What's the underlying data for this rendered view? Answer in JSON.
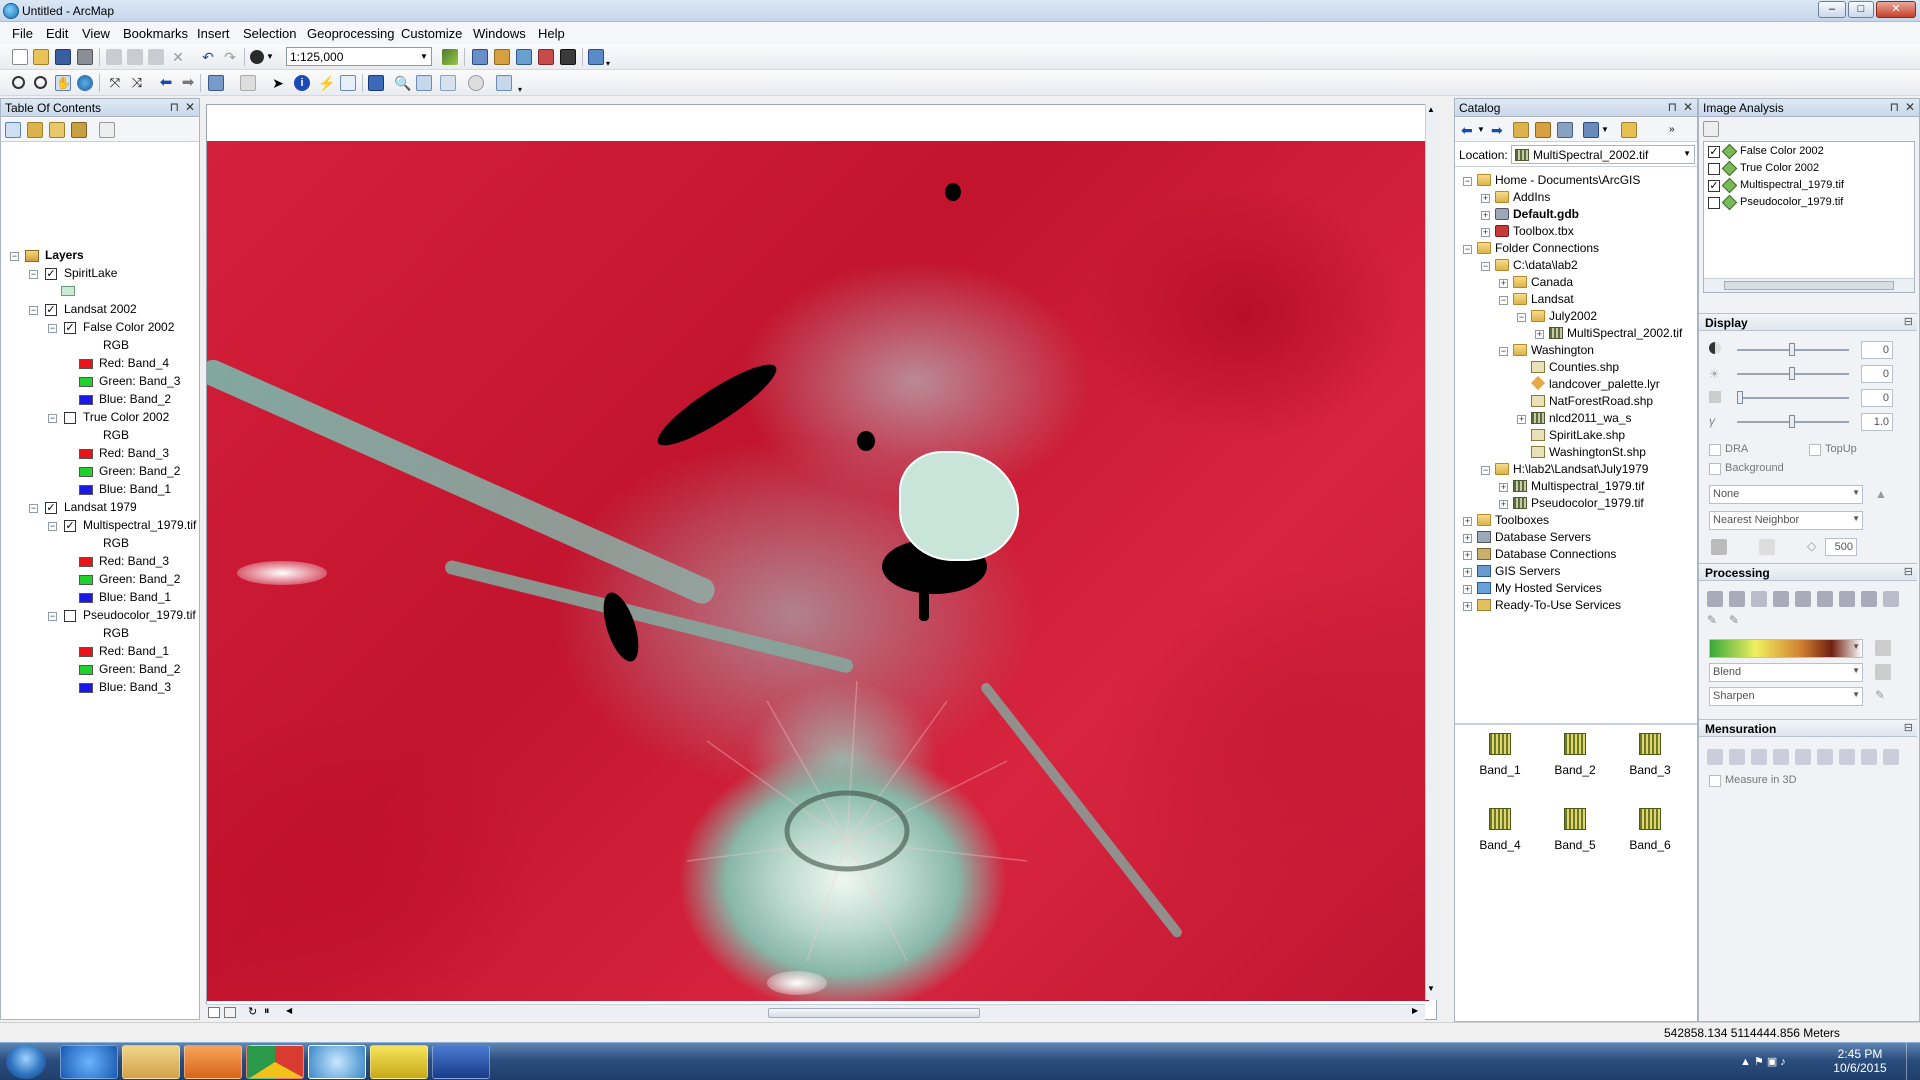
{
  "window": {
    "title": "Untitled - ArcMap",
    "min": "–",
    "max": "□",
    "close": "✕"
  },
  "menu": [
    "File",
    "Edit",
    "View",
    "Bookmarks",
    "Insert",
    "Selection",
    "Geoprocessing",
    "Customize",
    "Windows",
    "Help"
  ],
  "toolbar": {
    "scale": "1:125,000"
  },
  "toc": {
    "title": "Table Of Contents",
    "layers_label": "Layers",
    "spirit_lake": "SpiritLake",
    "landsat2002": "Landsat 2002",
    "false_color_2002": "False Color 2002",
    "true_color_2002": "True Color 2002",
    "landsat1979": "Landsat 1979",
    "multispectral_1979": "Multispectral_1979.tif",
    "pseudocolor_1979": "Pseudocolor_1979.tif",
    "rgb": "RGB",
    "fc2002": {
      "red": "Red:   Band_4",
      "green": "Green: Band_3",
      "blue": "Blue:  Band_2"
    },
    "tc2002": {
      "red": "Red:   Band_3",
      "green": "Green: Band_2",
      "blue": "Blue:  Band_1"
    },
    "ms1979": {
      "red": "Red:   Band_3",
      "green": "Green: Band_2",
      "blue": "Blue:  Band_1"
    },
    "pc1979": {
      "red": "Red:   Band_1",
      "green": "Green: Band_2",
      "blue": "Blue:  Band_3"
    },
    "colors": {
      "red": "#e8141c",
      "green": "#1fd12a",
      "blue": "#1a1ae6"
    }
  },
  "catalog": {
    "title": "Catalog",
    "location_label": "Location:",
    "location_value": "MultiSpectral_2002.tif",
    "tree": {
      "home": "Home - Documents\\ArcGIS",
      "addins": "AddIns",
      "default_gdb": "Default.gdb",
      "toolbox": "Toolbox.tbx",
      "folder_connections": "Folder Connections",
      "cdata": "C:\\data\\lab2",
      "canada": "Canada",
      "landsat": "Landsat",
      "july2002": "July2002",
      "ms2002": "MultiSpectral_2002.tif",
      "washington": "Washington",
      "counties": "Counties.shp",
      "landcover": "landcover_palette.lyr",
      "natforest": "NatForestRoad.shp",
      "nlcd": "nlcd2011_wa_s",
      "spiritlake": "SpiritLake.shp",
      "washst": "WashingtonSt.shp",
      "hpath": "H:\\lab2\\Landsat\\July1979",
      "ms1979": "Multispectral_1979.tif",
      "pc1979": "Pseudocolor_1979.tif",
      "toolboxes": "Toolboxes",
      "dbservers": "Database Servers",
      "dbconn": "Database Connections",
      "gis": "GIS Servers",
      "hosted": "My Hosted Services",
      "ready": "Ready-To-Use Services"
    },
    "bands": [
      "Band_1",
      "Band_2",
      "Band_3",
      "Band_4",
      "Band_5",
      "Band_6"
    ]
  },
  "image_analysis": {
    "title": "Image Analysis",
    "layers": [
      "False Color 2002",
      "True Color 2002",
      "Multispectral_1979.tif",
      "Pseudocolor_1979.tif"
    ],
    "display": "Display",
    "values": [
      "0",
      "0",
      "0",
      "1.0"
    ],
    "dra": "DRA",
    "topup": "TopUp",
    "background": "Background",
    "none": "None",
    "nearest": "Nearest Neighbor",
    "resample_val": "500",
    "processing": "Processing",
    "blend": "Blend",
    "sharpen": "Sharpen",
    "mensuration": "Mensuration",
    "measure3d": "Measure in 3D"
  },
  "status": {
    "coords": "542858.134  5114444.856 Meters"
  },
  "taskbar": {
    "time": "2:45 PM",
    "date": "10/6/2015"
  }
}
